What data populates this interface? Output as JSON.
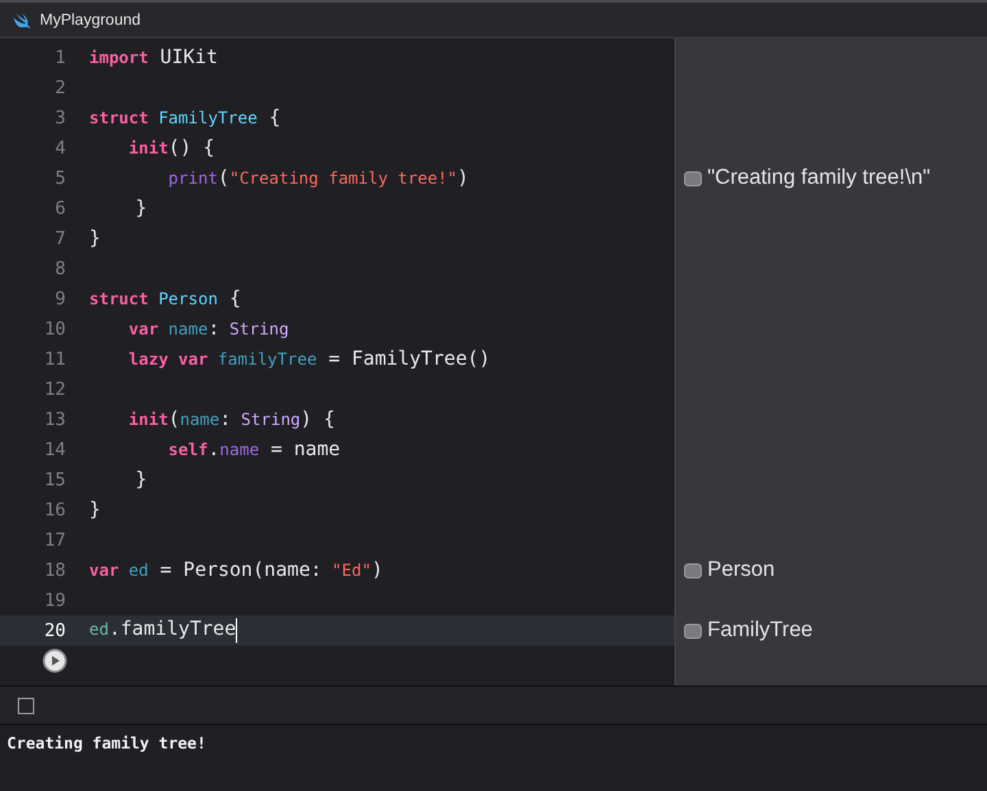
{
  "window": {
    "title": "MyPlayground"
  },
  "editor": {
    "lines": [
      {
        "number": "1",
        "current": false,
        "tokens": [
          {
            "text": "import",
            "kind": "keyword"
          },
          {
            "text": " UIKit",
            "kind": "plain"
          }
        ]
      },
      {
        "number": "2",
        "current": false
      },
      {
        "number": "3",
        "current": false,
        "tokens": [
          {
            "text": "struct",
            "kind": "keyword"
          },
          {
            "text": " FamilyTree",
            "kind": "type"
          },
          {
            "text": " {",
            "kind": "plain"
          }
        ]
      },
      {
        "number": "4",
        "current": false,
        "tokens": [
          {
            "text": "    init",
            "kind": "keyword"
          },
          {
            "text": "() {",
            "kind": "plain"
          }
        ]
      },
      {
        "number": "5",
        "current": false,
        "tokens": [
          {
            "text": "        print",
            "kind": "function"
          },
          {
            "text": "(",
            "kind": "plain"
          },
          {
            "text": "\"Creating family tree!\"",
            "kind": "string"
          },
          {
            "text": ")",
            "kind": "plain"
          }
        ],
        "result": "\"Creating family tree!\\n\""
      },
      {
        "number": "6",
        "current": false,
        "tokens": [
          {
            "text": "    }",
            "kind": "plain"
          }
        ]
      },
      {
        "number": "7",
        "current": false,
        "tokens": [
          {
            "text": "}",
            "kind": "plain"
          }
        ]
      },
      {
        "number": "8",
        "current": false
      },
      {
        "number": "9",
        "current": false,
        "tokens": [
          {
            "text": "struct",
            "kind": "keyword"
          },
          {
            "text": " Person",
            "kind": "type"
          },
          {
            "text": " {",
            "kind": "plain"
          }
        ]
      },
      {
        "number": "10",
        "current": false,
        "tokens": [
          {
            "text": "    var",
            "kind": "keyword"
          },
          {
            "text": " name",
            "kind": "identifier"
          },
          {
            "text": ":",
            "kind": "plain"
          },
          {
            "text": " String",
            "kind": "library"
          }
        ]
      },
      {
        "number": "11",
        "current": false,
        "tokens": [
          {
            "text": "    lazy",
            "kind": "keyword"
          },
          {
            "text": " var",
            "kind": "keyword"
          },
          {
            "text": " familyTree",
            "kind": "identifier"
          },
          {
            "text": " = FamilyTree()",
            "kind": "plain"
          }
        ]
      },
      {
        "number": "12",
        "current": false
      },
      {
        "number": "13",
        "current": false,
        "tokens": [
          {
            "text": "    init",
            "kind": "keyword"
          },
          {
            "text": "(",
            "kind": "plain"
          },
          {
            "text": "name",
            "kind": "identifier"
          },
          {
            "text": ":",
            "kind": "plain"
          },
          {
            "text": " String",
            "kind": "library"
          },
          {
            "text": ") {",
            "kind": "plain"
          }
        ]
      },
      {
        "number": "14",
        "current": false,
        "tokens": [
          {
            "text": "        self",
            "kind": "keyword"
          },
          {
            "text": ".",
            "kind": "plain"
          },
          {
            "text": "name",
            "kind": "member"
          },
          {
            "text": " = name",
            "kind": "plain"
          }
        ]
      },
      {
        "number": "15",
        "current": false,
        "tokens": [
          {
            "text": "    }",
            "kind": "plain"
          }
        ]
      },
      {
        "number": "16",
        "current": false,
        "tokens": [
          {
            "text": "}",
            "kind": "plain"
          }
        ]
      },
      {
        "number": "17",
        "current": false
      },
      {
        "number": "18",
        "current": false,
        "tokens": [
          {
            "text": "var",
            "kind": "keyword"
          },
          {
            "text": " ed",
            "kind": "identifier"
          },
          {
            "text": " = Person(name:",
            "kind": "plain"
          },
          {
            "text": " \"Ed\"",
            "kind": "string"
          },
          {
            "text": ")",
            "kind": "plain"
          }
        ],
        "result": "Person"
      },
      {
        "number": "19",
        "current": false
      },
      {
        "number": "20",
        "current": true,
        "tokens": [
          {
            "text": "ed",
            "kind": "variable"
          },
          {
            "text": ".familyTree",
            "kind": "plain"
          }
        ],
        "result": "FamilyTree"
      }
    ]
  },
  "console": {
    "output": "Creating family tree!"
  }
}
